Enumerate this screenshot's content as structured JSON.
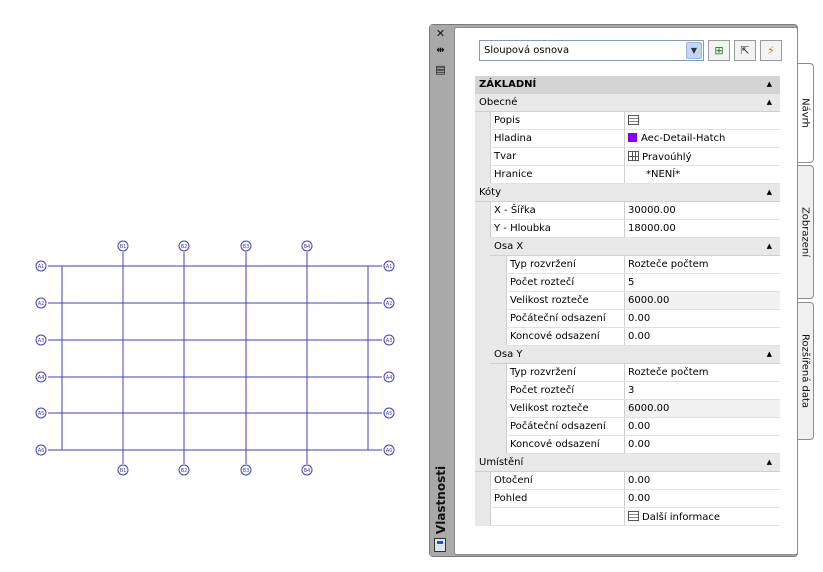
{
  "drawing": {
    "top_labels": [
      "B1",
      "B2",
      "B3",
      "B4"
    ],
    "bottom_labels": [
      "B1",
      "B2",
      "B3",
      "B4"
    ],
    "left_labels": [
      "A1",
      "A2",
      "A3",
      "A4",
      "A5",
      "A6"
    ],
    "right_labels": [
      "A1",
      "A2",
      "A3",
      "A4",
      "A5",
      "A6"
    ],
    "line_color": "#4040c0"
  },
  "palette": {
    "title": "Vlastnosti",
    "tabs": [
      "Návrh",
      "Zobrazení",
      "Rozšířená data"
    ],
    "active_tab": "Návrh",
    "style_select": "Sloupová osnova",
    "tools": [
      "quick-select-icon",
      "select-objects-icon",
      "toggle-pickadd-icon"
    ]
  },
  "properties": {
    "basic": "ZÁKLADNÍ",
    "general": {
      "label": "Obecné",
      "popis": "Popis",
      "hladina": "Hladina",
      "hladina_value": "Aec-Detail-Hatch",
      "hladina_color": "#8000ff",
      "tvar": "Tvar",
      "tvar_value": "Pravoúhlý",
      "hranice": "Hranice",
      "hranice_value": "*NENÍ*"
    },
    "dims": {
      "label": "Kóty",
      "x_label": "X - Šířka",
      "x_value": "30000.00",
      "y_label": "Y - Hloubka",
      "y_value": "18000.00"
    },
    "axis_x": {
      "label": "Osa X",
      "layout_type": "Typ rozvržení",
      "layout_type_value": "Rozteče počtem",
      "bay_count": "Počet roztečí",
      "bay_count_value": "5",
      "bay_size": "Velikost rozteče",
      "bay_size_value": "6000.00",
      "start_offset": "Počáteční odsazení",
      "start_offset_value": "0.00",
      "end_offset": "Koncové odsazení",
      "end_offset_value": "0.00"
    },
    "axis_y": {
      "label": "Osa Y",
      "layout_type": "Typ rozvržení",
      "layout_type_value": "Rozteče počtem",
      "bay_count": "Počet roztečí",
      "bay_count_value": "3",
      "bay_size": "Velikost rozteče",
      "bay_size_value": "6000.00",
      "start_offset": "Počáteční odsazení",
      "start_offset_value": "0.00",
      "end_offset": "Koncové odsazení",
      "end_offset_value": "0.00"
    },
    "location": {
      "label": "Umístění",
      "rotation": "Otočení",
      "rotation_value": "0.00",
      "view": "Pohled",
      "view_value": "0.00",
      "more_info": "Další informace"
    }
  }
}
